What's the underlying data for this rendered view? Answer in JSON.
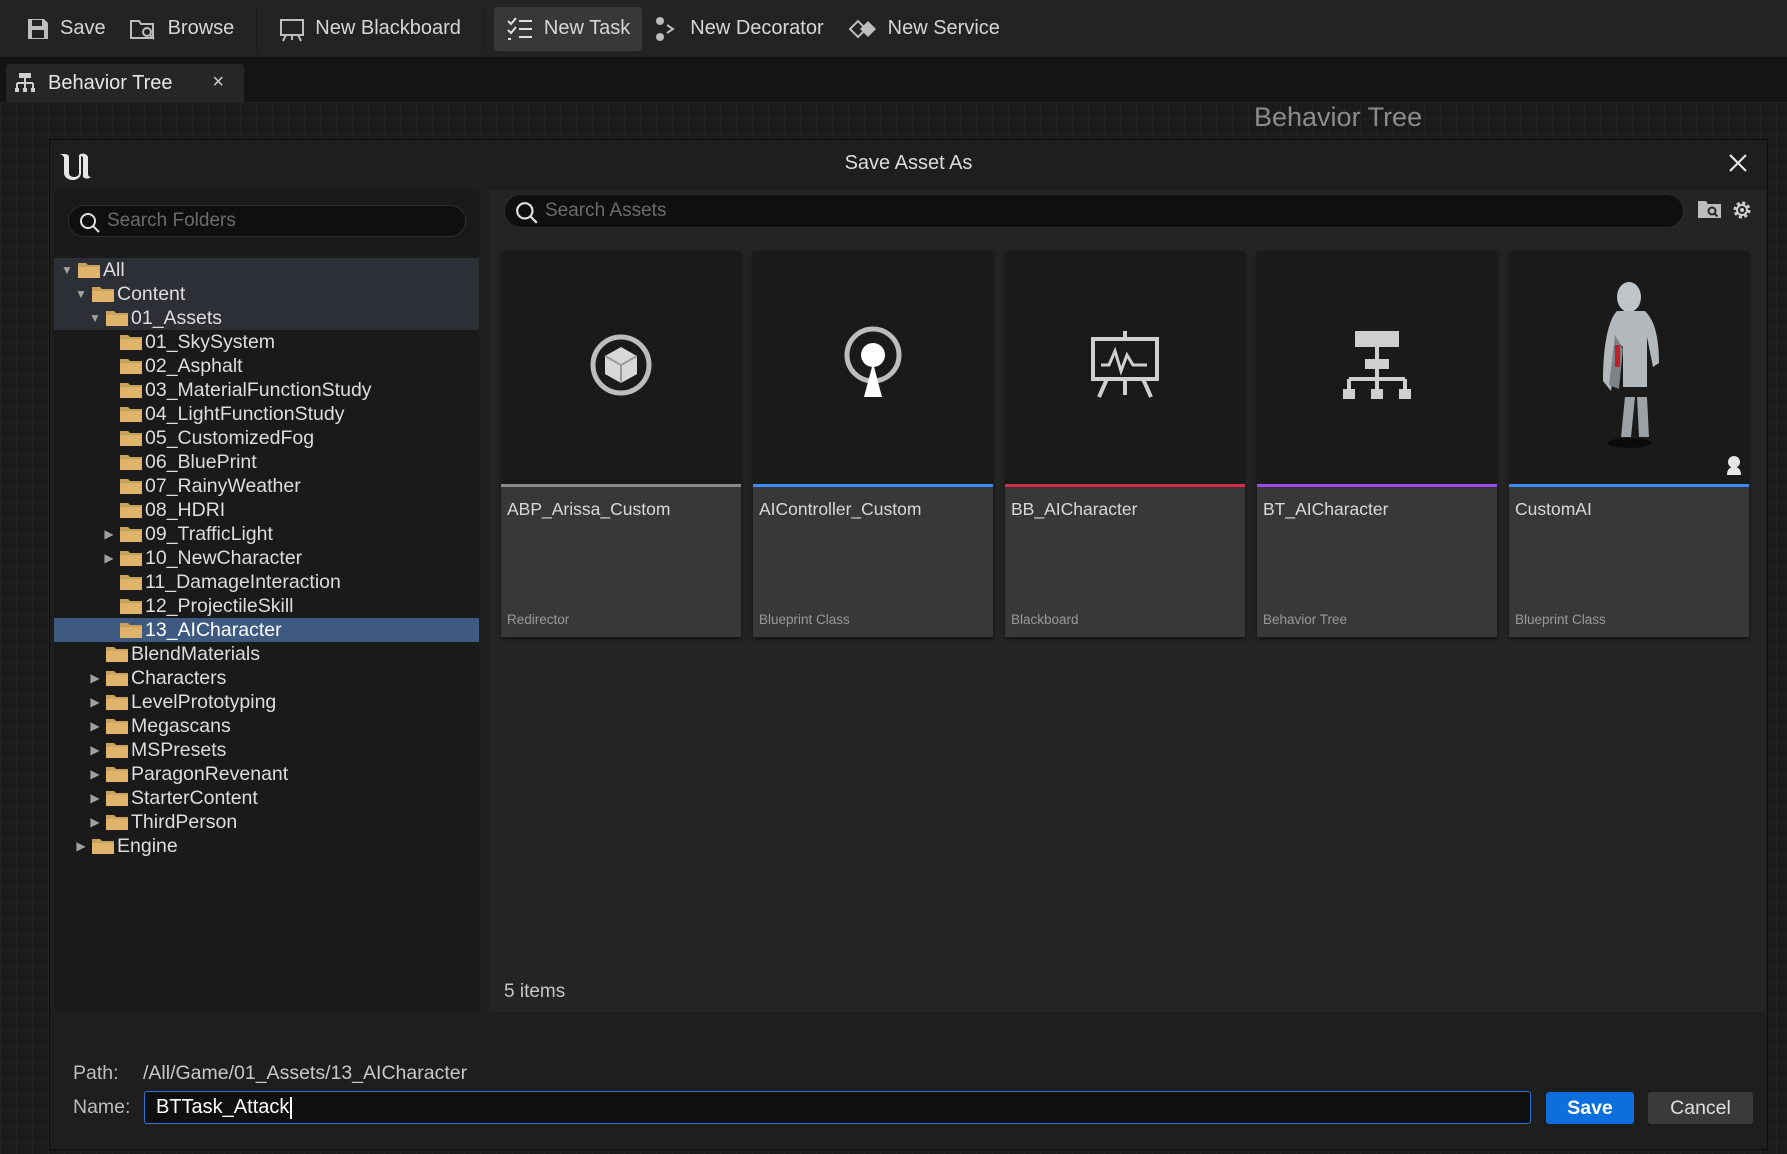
{
  "toolbar": {
    "save": "Save",
    "browse": "Browse",
    "new_blackboard": "New Blackboard",
    "new_task": "New Task",
    "new_decorator": "New Decorator",
    "new_service": "New Service"
  },
  "tab": {
    "label": "Behavior Tree",
    "close": "×"
  },
  "graph": {
    "title": "Behavior Tree"
  },
  "dialog": {
    "title": "Save Asset As",
    "search_folders_placeholder": "Search Folders",
    "search_assets_placeholder": "Search Assets",
    "tree": [
      {
        "label": "All",
        "depth": 0,
        "arrow": "down",
        "state": "hl"
      },
      {
        "label": "Content",
        "depth": 1,
        "arrow": "down",
        "state": "hl"
      },
      {
        "label": "01_Assets",
        "depth": 2,
        "arrow": "down",
        "state": "hl"
      },
      {
        "label": "01_SkySystem",
        "depth": 3,
        "arrow": "",
        "state": ""
      },
      {
        "label": "02_Asphalt",
        "depth": 3,
        "arrow": "",
        "state": ""
      },
      {
        "label": "03_MaterialFunctionStudy",
        "depth": 3,
        "arrow": "",
        "state": ""
      },
      {
        "label": "04_LightFunctionStudy",
        "depth": 3,
        "arrow": "",
        "state": ""
      },
      {
        "label": "05_CustomizedFog",
        "depth": 3,
        "arrow": "",
        "state": ""
      },
      {
        "label": "06_BluePrint",
        "depth": 3,
        "arrow": "",
        "state": ""
      },
      {
        "label": "07_RainyWeather",
        "depth": 3,
        "arrow": "",
        "state": ""
      },
      {
        "label": "08_HDRI",
        "depth": 3,
        "arrow": "",
        "state": ""
      },
      {
        "label": "09_TrafficLight",
        "depth": 3,
        "arrow": "right",
        "state": ""
      },
      {
        "label": "10_NewCharacter",
        "depth": 3,
        "arrow": "right",
        "state": ""
      },
      {
        "label": "11_DamageInteraction",
        "depth": 3,
        "arrow": "",
        "state": ""
      },
      {
        "label": "12_ProjectileSkill",
        "depth": 3,
        "arrow": "",
        "state": ""
      },
      {
        "label": "13_AICharacter",
        "depth": 3,
        "arrow": "",
        "state": "sel"
      },
      {
        "label": "BlendMaterials",
        "depth": 2,
        "arrow": "",
        "state": ""
      },
      {
        "label": "Characters",
        "depth": 2,
        "arrow": "right",
        "state": ""
      },
      {
        "label": "LevelPrototyping",
        "depth": 2,
        "arrow": "right",
        "state": ""
      },
      {
        "label": "Megascans",
        "depth": 2,
        "arrow": "right",
        "state": ""
      },
      {
        "label": "MSPresets",
        "depth": 2,
        "arrow": "right",
        "state": ""
      },
      {
        "label": "ParagonRevenant",
        "depth": 2,
        "arrow": "right",
        "state": ""
      },
      {
        "label": "StarterContent",
        "depth": 2,
        "arrow": "right",
        "state": ""
      },
      {
        "label": "ThirdPerson",
        "depth": 2,
        "arrow": "right",
        "state": ""
      },
      {
        "label": "Engine",
        "depth": 1,
        "arrow": "right",
        "state": ""
      }
    ],
    "assets": [
      {
        "name": "ABP_Arissa_Custom",
        "type": "Redirector",
        "icon": "redirector-icon",
        "color": "#8a8a8a"
      },
      {
        "name": "AIController_Custom",
        "type": "Blueprint Class",
        "icon": "aicontroller-icon",
        "color": "#3d8bf0"
      },
      {
        "name": "BB_AICharacter",
        "type": "Blackboard",
        "icon": "blackboard-icon",
        "color": "#d02c4e"
      },
      {
        "name": "BT_AICharacter",
        "type": "Behavior Tree",
        "icon": "behavior-tree-icon",
        "color": "#9a4fe0"
      },
      {
        "name": "CustomAI",
        "type": "Blueprint Class",
        "icon": "character-thumbnail",
        "color": "#3d8bf0"
      }
    ],
    "items_count": "5 items",
    "path_label": "Path:",
    "path_value": "/All/Game/01_Assets/13_AICharacter",
    "name_label": "Name:",
    "name_value": "BTTask_Attack",
    "save_button": "Save",
    "cancel_button": "Cancel"
  }
}
